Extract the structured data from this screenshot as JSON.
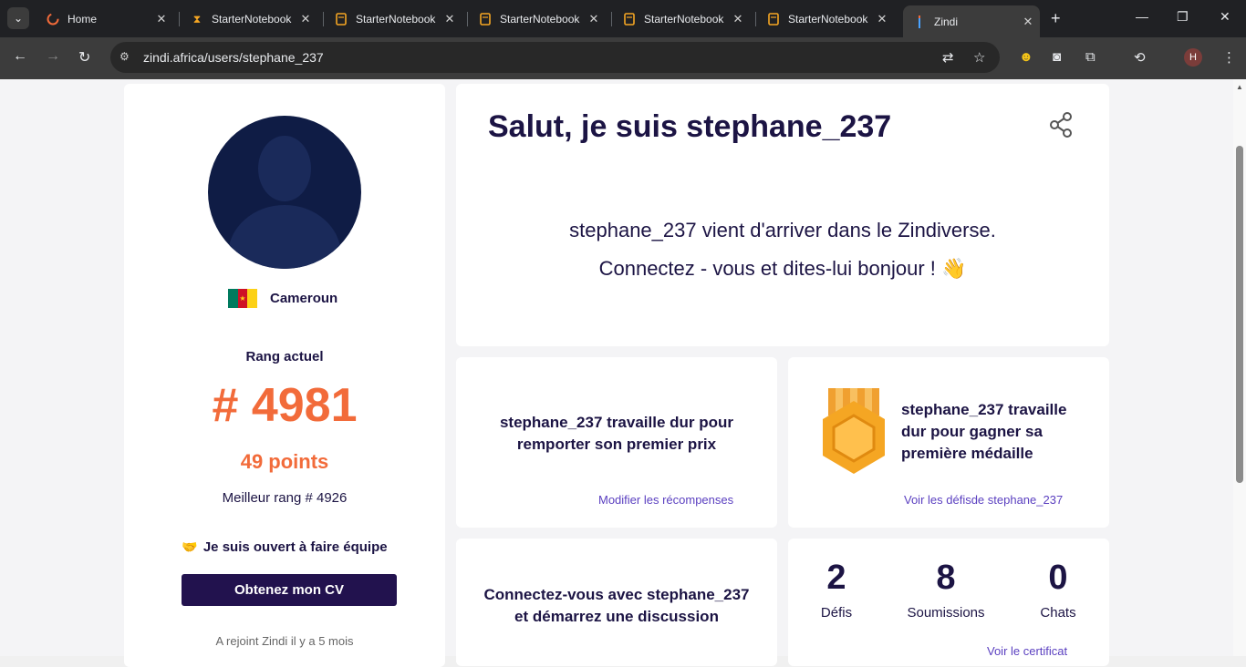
{
  "browser": {
    "tabs": [
      {
        "title": "Home",
        "icon": "zindi-logo-icon"
      },
      {
        "title": "StarterNotebook",
        "icon": "hourglass-icon"
      },
      {
        "title": "StarterNotebook",
        "icon": "notebook-icon"
      },
      {
        "title": "StarterNotebook",
        "icon": "notebook-icon"
      },
      {
        "title": "StarterNotebook",
        "icon": "notebook-icon"
      },
      {
        "title": "StarterNotebook",
        "icon": "notebook-icon"
      },
      {
        "title": "Zindi",
        "icon": "zindi-icon"
      }
    ],
    "url": "zindi.africa/users/stephane_237",
    "profile_initial": "H"
  },
  "profile": {
    "country": "Cameroun",
    "rank_label": "Rang actuel",
    "rank": "# 4981",
    "points": "49 points",
    "best_rank": "Meilleur rang # 4926",
    "team_text": "Je suis ouvert à faire équipe",
    "cv_button": "Obtenez mon CV",
    "joined": "A rejoint Zindi il y a 5 mois"
  },
  "hero": {
    "title": "Salut, je suis stephane_237",
    "line1": "stephane_237 vient d'arriver dans le Zindiverse.",
    "line2": "Connectez  - vous et dites-lui bonjour ! 👋"
  },
  "prize": {
    "text": "stephane_237 travaille dur pour remporter son premier prix",
    "link": "Modifier les récompenses"
  },
  "medal": {
    "text": "stephane_237 travaille dur pour gagner sa première médaille",
    "link": "Voir les défisde stephane_237"
  },
  "connect": {
    "text": "Connectez-vous avec stephane_237 et démarrez une discussion"
  },
  "stats": {
    "items": [
      {
        "value": "2",
        "label": "Défis"
      },
      {
        "value": "8",
        "label": "Soumissions"
      },
      {
        "value": "0",
        "label": "Chats"
      }
    ],
    "cert_link": "Voir le certificat"
  },
  "colors": {
    "accent_orange": "#f26b3a",
    "navy": "#1c1444",
    "button": "#22124e",
    "link": "#5a3fc0"
  }
}
